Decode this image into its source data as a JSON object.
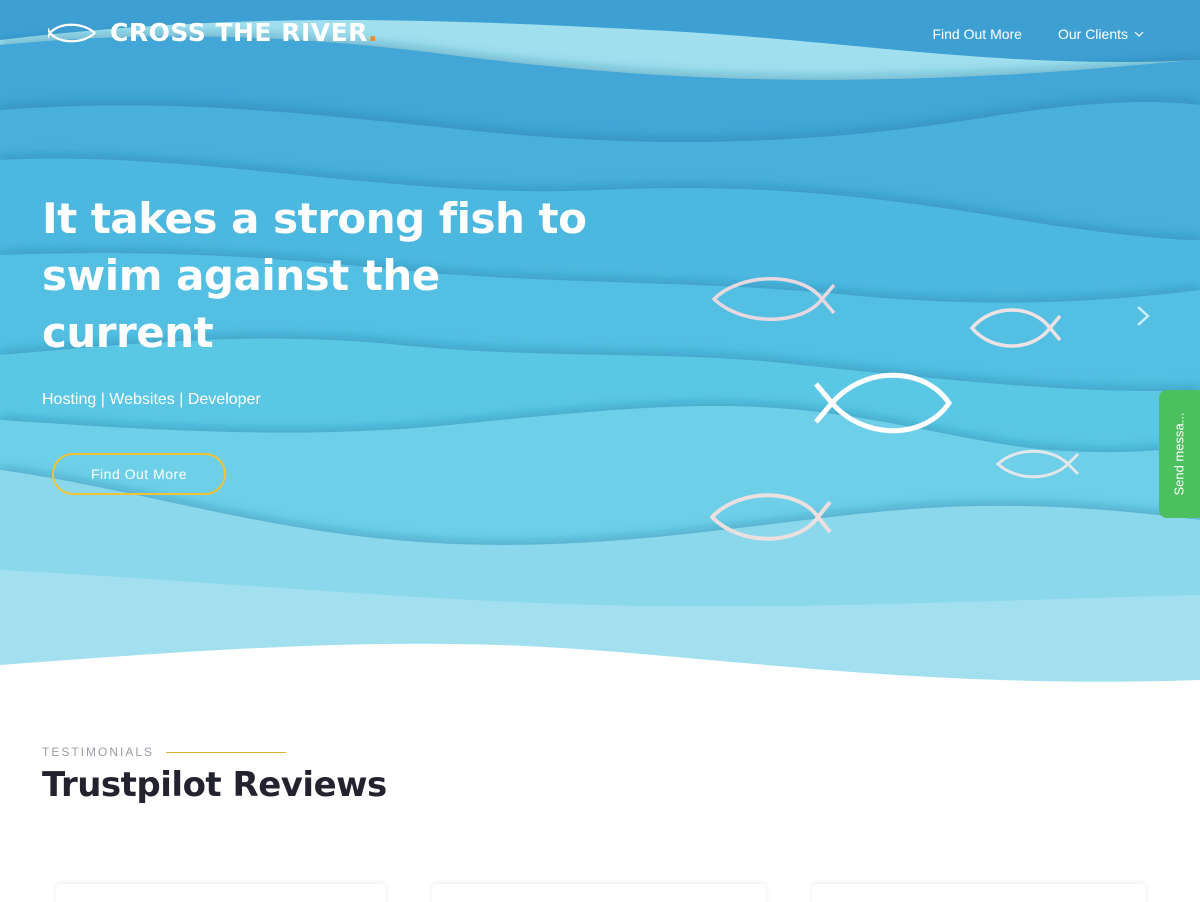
{
  "header": {
    "brand": "CROSS THE RIVER",
    "brand_dot": ".",
    "nav": [
      {
        "label": "Find Out More"
      },
      {
        "label": "Our Clients",
        "icon": "chevron-down-icon"
      }
    ]
  },
  "hero": {
    "headline": "It takes a strong fish to swim against the current",
    "subline": "Hosting | Websites | Developer",
    "cta_label": "Find Out More",
    "next_icon": "chevron-right-icon",
    "fish_icon": "fish-icon"
  },
  "chat": {
    "label": "Send messa..."
  },
  "testimonials": {
    "eyebrow": "TESTIMONIALS",
    "title": "Trustpilot Reviews"
  },
  "colors": {
    "accent_orange": "#f08a24",
    "cta_border": "#f2c233",
    "chat_green": "#4cbf5e",
    "heading_dark": "#23232f",
    "water_dark": "#45a9d8",
    "water_mid": "#54c3e4",
    "water_light": "#9ee0ed"
  }
}
